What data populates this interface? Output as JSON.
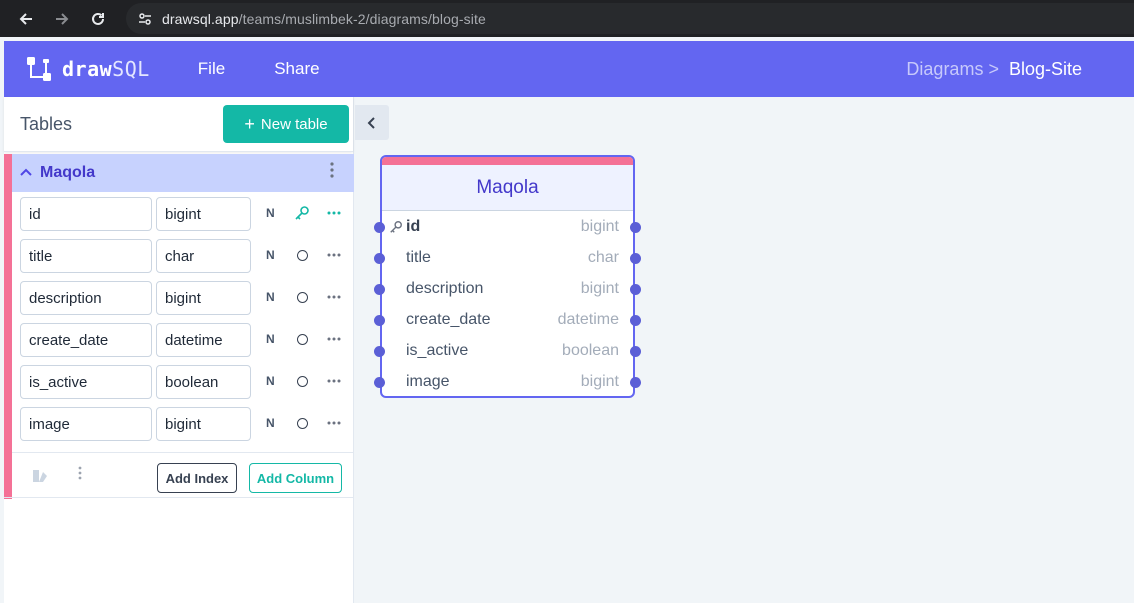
{
  "browser": {
    "url_host": "drawsql.app",
    "url_path": "/teams/muslimbek-2/diagrams/blog-site"
  },
  "header": {
    "logo_bold": "draw",
    "logo_light": "SQL",
    "menu": [
      "File",
      "Share"
    ],
    "breadcrumb_link": "Diagrams >",
    "breadcrumb_current": "Blog-Site",
    "accent_color": "#6366f1"
  },
  "sidebar": {
    "title": "Tables",
    "new_table_label": "New table",
    "table": {
      "name": "Maqola",
      "color": "#f47196",
      "fields": [
        {
          "name": "id",
          "type": "bigint",
          "nullable": "N",
          "primary": true
        },
        {
          "name": "title",
          "type": "char",
          "nullable": "N",
          "primary": false
        },
        {
          "name": "description",
          "type": "bigint",
          "nullable": "N",
          "primary": false
        },
        {
          "name": "create_date",
          "type": "datetime",
          "nullable": "N",
          "primary": false
        },
        {
          "name": "is_active",
          "type": "boolean",
          "nullable": "N",
          "primary": false
        },
        {
          "name": "image",
          "type": "bigint",
          "nullable": "N",
          "primary": false
        }
      ],
      "add_index_label": "Add Index",
      "add_column_label": "Add Column"
    }
  },
  "diagram": {
    "card_title": "Maqola",
    "rows": [
      {
        "name": "id",
        "type": "bigint"
      },
      {
        "name": "title",
        "type": "char"
      },
      {
        "name": "description",
        "type": "bigint"
      },
      {
        "name": "create_date",
        "type": "datetime"
      },
      {
        "name": "is_active",
        "type": "boolean"
      },
      {
        "name": "image",
        "type": "bigint"
      }
    ]
  }
}
